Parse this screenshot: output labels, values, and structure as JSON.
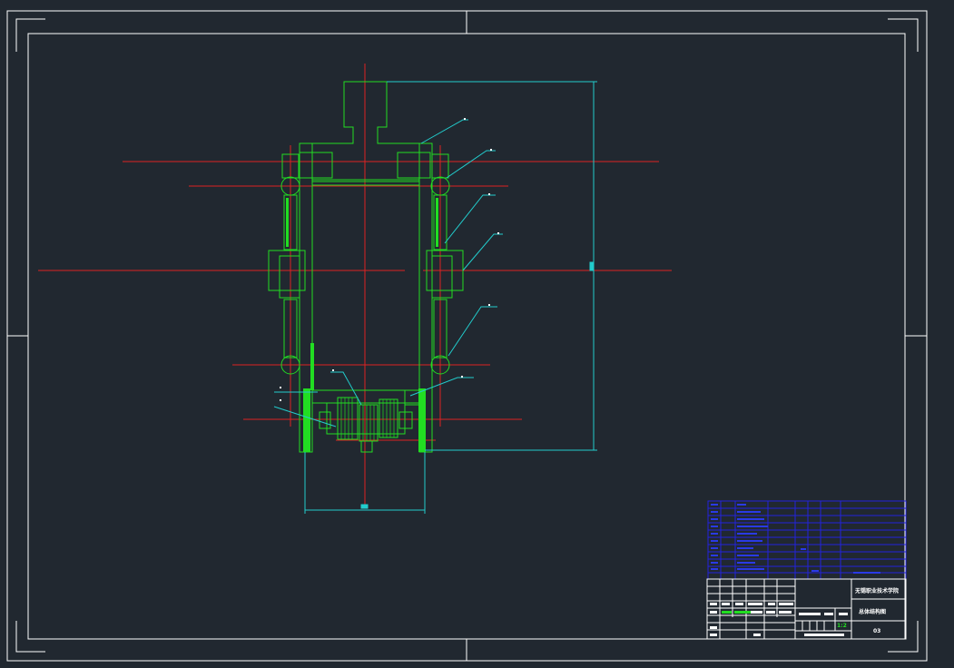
{
  "drawing": {
    "background": "#212830",
    "colors": {
      "frame": "#ffffff",
      "part": "#22dd22",
      "centerline": "#dd2222",
      "dimension": "#22cccc",
      "bom": "#2222dd",
      "title_block": "#ffffff"
    }
  },
  "title_block": {
    "school": "无锡职业技术学院",
    "drawing_name": "总体结构图",
    "scale": "1:2",
    "sheet_size": "03"
  }
}
